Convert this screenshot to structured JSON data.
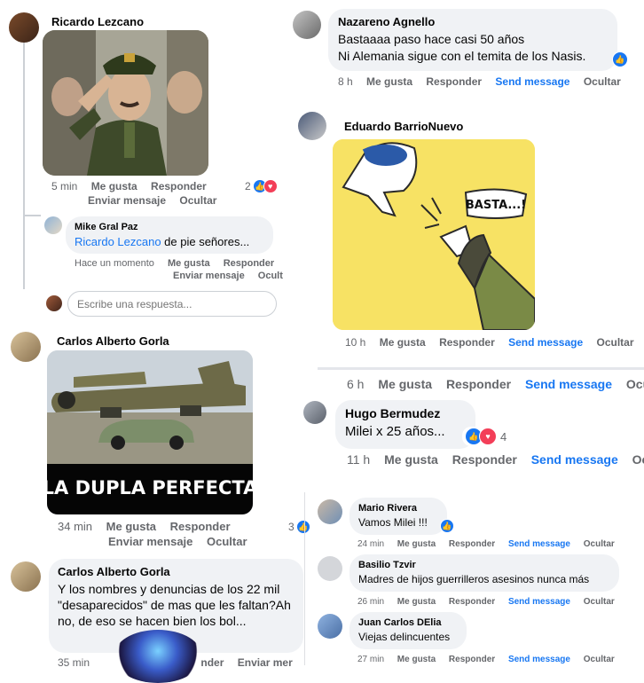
{
  "left": {
    "c1": {
      "name": "Ricardo Lezcano",
      "time": "5 min",
      "like": "Me gusta",
      "reply": "Responder",
      "msg": "Enviar mensaje",
      "hide": "Ocultar",
      "react_count": "2"
    },
    "c1_reply": {
      "name": "Mike Gral Paz",
      "mention": "Ricardo Lezcano",
      "text": " de pie señores...",
      "time": "Hace un momento",
      "like": "Me gusta",
      "reply": "Responder",
      "msg": "Enviar mensaje",
      "hide": "Ocult"
    },
    "reply_input": {
      "placeholder": "Escribe una respuesta..."
    },
    "c2": {
      "name": "Carlos Alberto Gorla",
      "caption": "LA DUPLA PERFECTA",
      "time": "34 min",
      "like": "Me gusta",
      "reply": "Responder",
      "msg": "Enviar mensaje",
      "hide": "Ocultar",
      "react_count": "3"
    },
    "c3": {
      "name": "Carlos Alberto Gorla",
      "text": "Y los nombres y denuncias de los 22 mil \"desaparecidos\" de mas que les faltan?Ah no, de eso se hacen bien los bol...",
      "time": "35 min",
      "reply": "nder",
      "msg": "Enviar mer"
    }
  },
  "right": {
    "c1": {
      "name": "Nazareno Agnello",
      "line1": "Bastaaaa paso hace casi 50 años",
      "line2": "Ni Alemania sigue con el temita de los Nasis.",
      "time": "8 h",
      "like": "Me gusta",
      "reply": "Responder",
      "send": "Send message",
      "hide": "Ocultar"
    },
    "c2": {
      "name": "Eduardo BarrioNuevo",
      "speech": "BASTA...!",
      "time": "10 h",
      "like": "Me gusta",
      "reply": "Responder",
      "send": "Send message",
      "hide": "Ocultar"
    },
    "bar3": {
      "time": "6 h",
      "like": "Me gusta",
      "reply": "Responder",
      "send": "Send message",
      "hide": "Ocu"
    },
    "c4": {
      "name": "Hugo Bermudez",
      "text": "Milei x 25 años...",
      "react_count": "4",
      "time": "11 h",
      "like": "Me gusta",
      "reply": "Responder",
      "send": "Send message",
      "hide": "Oc"
    },
    "c5": {
      "name": "Mario Rivera",
      "text": "Vamos Milei !!!",
      "time": "24 min",
      "like": "Me gusta",
      "reply": "Responder",
      "send": "Send message",
      "hide": "Ocultar"
    },
    "c6": {
      "name": "Basilio Tzvir",
      "text": "Madres de hijos guerrilleros asesinos nunca más",
      "time": "26 min",
      "like": "Me gusta",
      "reply": "Responder",
      "send": "Send message",
      "hide": "Ocultar"
    },
    "c7": {
      "name": "Juan Carlos DElia",
      "text": "Viejas delincuentes",
      "time": "27 min",
      "like": "Me gusta",
      "reply": "Responder",
      "send": "Send message",
      "hide": "Ocultar"
    }
  },
  "colors": {
    "link": "#1877f2",
    "meta": "#65676b",
    "bubble": "#f0f2f5",
    "like": "#1877f2",
    "love": "#f33e58"
  },
  "icons": [
    "like-icon",
    "love-icon",
    "avatar"
  ]
}
